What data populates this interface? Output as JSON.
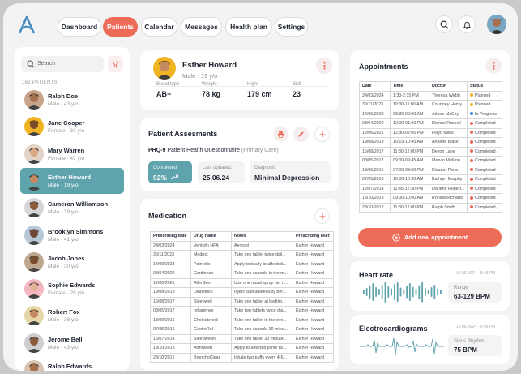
{
  "nav": {
    "tabs": [
      {
        "label": "Dashboard"
      },
      {
        "label": "Patients"
      },
      {
        "label": "Calendar"
      },
      {
        "label": "Messages"
      },
      {
        "label": "Health plan"
      },
      {
        "label": "Settings"
      }
    ],
    "active_tab": "Patients"
  },
  "sidebar": {
    "search_placeholder": "Search",
    "count_label": "162 PATIENTS",
    "patients": [
      {
        "name": "Ralph Doe",
        "meta": "Male · 43 y/o"
      },
      {
        "name": "Jane Cooper",
        "meta": "Female · 31 y/o"
      },
      {
        "name": "Mary Warren",
        "meta": "Female · 47 y/o"
      },
      {
        "name": "Esther Howard",
        "meta": "Male · 19 y/o"
      },
      {
        "name": "Cameron Williamson",
        "meta": "Male · 39 y/o"
      },
      {
        "name": "Brooklyn Simmons",
        "meta": "Male · 41 y/o"
      },
      {
        "name": "Jacob Jones",
        "meta": "Male · 30 y/o"
      },
      {
        "name": "Sophie Edwards",
        "meta": "Female · 28 y/o"
      },
      {
        "name": "Robert Fox",
        "meta": "Male · 36 y/o"
      },
      {
        "name": "Jerome Bell",
        "meta": "Male · 43 y/o"
      },
      {
        "name": "Ralph Edwards",
        "meta": "Male · 46 y/o"
      }
    ]
  },
  "profile": {
    "name": "Esther Howard",
    "meta": "Male · 19 y/o",
    "stats": [
      {
        "label": "Blood type",
        "value": "AB+"
      },
      {
        "label": "Weight",
        "value": "78 kg"
      },
      {
        "label": "Hight",
        "value": "179 cm"
      },
      {
        "label": "BMI",
        "value": "23"
      }
    ]
  },
  "assessments": {
    "title": "Patient Assesments",
    "code": "PHQ-9",
    "desc": "Patient Health Questionnaire",
    "context": "(Primary Care)",
    "completed_label": "Completed:",
    "completed_value": "92%",
    "completed_fraction": 0.92,
    "updated_label": "Last updated:",
    "updated_value": "25.06.24",
    "diagnosis_label": "Diagnosis",
    "diagnosis_value": "Minimal Depression"
  },
  "medication": {
    "title": "Medication",
    "headers": [
      "Prescribing date",
      "Drug name",
      "Notes",
      "Prescribing user"
    ],
    "rows": [
      [
        "24/03/2024",
        "Ventolin HFA",
        "Aerosol",
        "Esther Howard"
      ],
      [
        "30/11/2023",
        "Medrox",
        "Take one tablet twice dail...",
        "Esther Howard"
      ],
      [
        "14/09/2023",
        "Painrelix",
        "Apply topically to affected...",
        "Esther Howard"
      ],
      [
        "08/04/2022",
        "Cardionex",
        "Take one capsule in the m...",
        "Esther Howard"
      ],
      [
        "12/06/2021",
        "AllerGon",
        "Use one nasal spray per n...",
        "Esther Howard"
      ],
      [
        "19/08/2019",
        "Diabetolin",
        "Inject subcutaneously bef...",
        "Esther Howard"
      ],
      [
        "15/08/2017",
        "Sleepwell",
        "Take one tablet at bedtim...",
        "Esther Howard"
      ],
      [
        "03/05/2017",
        "Inflammex",
        "Take two tablets twice dai...",
        "Esther Howard"
      ],
      [
        "18/09/2016",
        "Cholesteroid",
        "Take one tablet in the eve...",
        "Esther Howard"
      ],
      [
        "07/05/2016",
        "GastroRel",
        "Take one capsule 30 minu...",
        "Esther Howard"
      ],
      [
        "15/07/2014",
        "Sleepwellin",
        "Take one tablet 30 minute...",
        "Esther Howard"
      ],
      [
        "18/10/2013",
        "ArthriMed",
        "Apply to affected joints tw...",
        "Esther Howard"
      ],
      [
        "28/10/2012",
        "BronchoClear",
        "Inhale two puffs every 4-6...",
        "Esther Howard"
      ]
    ]
  },
  "appointments": {
    "title": "Appointments",
    "headers": [
      "Date",
      "Time",
      "Doctor",
      "Status"
    ],
    "rows": [
      [
        "24/03/2024",
        "1:30-2:15 PM",
        "Theresa Webb",
        "Planned"
      ],
      [
        "30/11/2023",
        "10:00-11:00 AM",
        "Courtney Henry",
        "Planned"
      ],
      [
        "14/09/2023",
        "08:30-09:00 AM",
        "Arlene McCoy",
        "In Progress"
      ],
      [
        "08/04/2022",
        "12:00-01:00 PM",
        "Dianne Russell",
        "Completed"
      ],
      [
        "12/06/2021",
        "12:30-02:00 PM",
        "Floyd Miles",
        "Completed"
      ],
      [
        "19/08/2019",
        "10:15-10:45 AM",
        "Annette Black",
        "Completed"
      ],
      [
        "15/08/2017",
        "11:30-12:00 PM",
        "Devon Lane",
        "Completed"
      ],
      [
        "03/05/2017",
        "09:00-09:45 AM",
        "Marvin McKinn...",
        "Completed"
      ],
      [
        "18/09/2016",
        "07:00-08:00 PM",
        "Eleanor Pena",
        "Completed"
      ],
      [
        "07/05/2016",
        "10:00-10:30 AM",
        "Kathryn Murphy",
        "Completed"
      ],
      [
        "12/07/2014",
        "11:45-12:30 PM",
        "Darlene Robert...",
        "Completed"
      ],
      [
        "18/10/2013",
        "09:00-10:00 AM",
        "Ronald Richards",
        "Completed"
      ],
      [
        "28/10/2012",
        "11:30-12:00 PM",
        "Ralph Smith",
        "Completed"
      ]
    ],
    "add_label": "Add new appointment",
    "status_colors": {
      "Planned": "#f0b323",
      "In Progress": "#3a86e8",
      "Completed": "#ec6c58"
    }
  },
  "heart": {
    "title": "Heart rate",
    "timestamp": "19.06.2024 · 5:48 PM",
    "range_label": "Range",
    "range_value": "63-129 BPM"
  },
  "ecg": {
    "title": "Electrocardiograms",
    "timestamp": "19.06.2024 · 5:48 PM",
    "rhythm_label": "Sinus Rhythm",
    "rhythm_value": "75 BPM"
  },
  "colors": {
    "accent": "#ec6c58",
    "teal": "#5fa3ad"
  }
}
